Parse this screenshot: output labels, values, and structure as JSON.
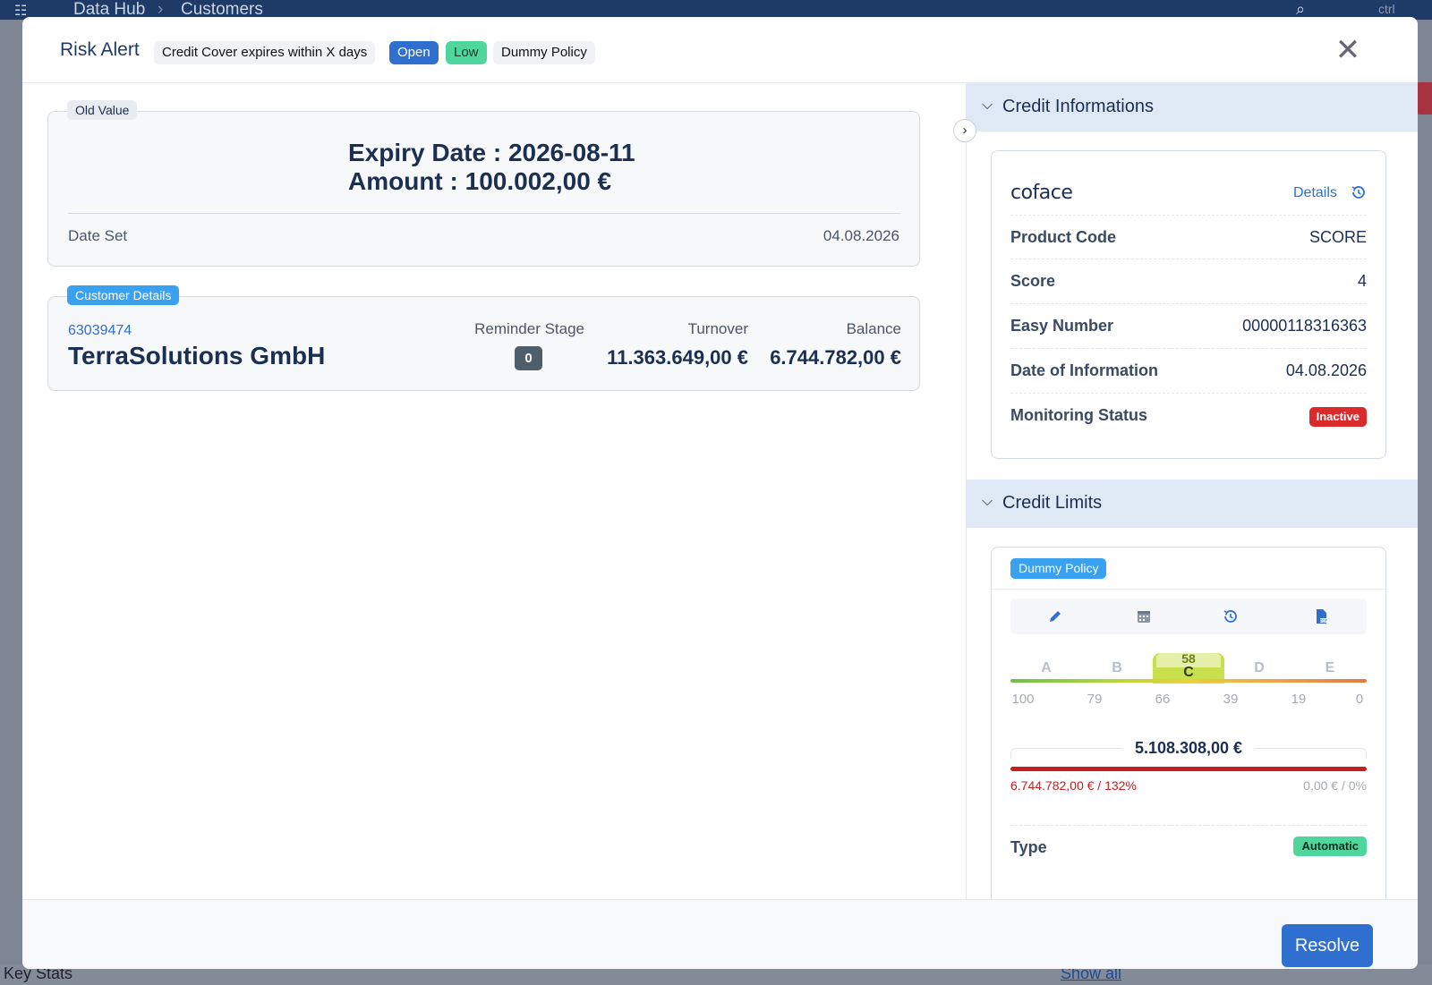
{
  "background": {
    "breadcrumb": [
      "Data Hub",
      "Customers"
    ],
    "footer_left": "Key Stats",
    "footer_right": "Show all",
    "hint": "ctrl"
  },
  "modal": {
    "title": "Risk Alert",
    "chips": {
      "rule": "Credit Cover expires within X days",
      "status": "Open",
      "severity": "Low",
      "policy": "Dummy Policy"
    },
    "old_value": {
      "tag": "Old Value",
      "expiry_line": "Expiry Date : 2026-08-11",
      "amount_line": "Amount : 100.002,00 €",
      "date_set_label": "Date Set",
      "date_set_value": "04.08.2026"
    },
    "customer": {
      "tag": "Customer Details",
      "id": "63039474",
      "name": "TerraSolutions GmbH",
      "reminder_stage_label": "Reminder Stage",
      "reminder_stage_value": "0",
      "turnover_label": "Turnover",
      "turnover_value": "11.363.649,00 €",
      "balance_label": "Balance",
      "balance_value": "6.744.782,00 €"
    },
    "credit_info": {
      "section_title": "Credit Informations",
      "provider": "coface",
      "details_link": "Details",
      "rows": [
        {
          "label": "Product Code",
          "value": "SCORE"
        },
        {
          "label": "Score",
          "value": "4"
        },
        {
          "label": "Easy Number",
          "value": "00000118316363"
        },
        {
          "label": "Date of Information",
          "value": "04.08.2026"
        }
      ],
      "monitoring_label": "Monitoring Status",
      "monitoring_value": "Inactive"
    },
    "credit_limits": {
      "section_title": "Credit Limits",
      "policy_tag": "Dummy Policy",
      "scale_letters": [
        "A",
        "B",
        "C",
        "D",
        "E"
      ],
      "scale_numbers": [
        "100",
        "79",
        "66",
        "39",
        "19",
        "0"
      ],
      "score_value": "58",
      "score_letter": "C",
      "limit_amount": "5.108.308,00 €",
      "used_text": "6.744.782,00 € / 132%",
      "remaining_text": "0,00 € / 0%",
      "type_label": "Type",
      "type_value": "Automatic"
    },
    "resolve_button": "Resolve"
  },
  "colors": {
    "primary": "#2f6fd0",
    "open_chip": "#2f6fd0",
    "low_chip": "#4fd69c",
    "inactive": "#d92b2b",
    "limit_exceeded": "#c51f1f",
    "section_header": "#dfe8f5"
  }
}
